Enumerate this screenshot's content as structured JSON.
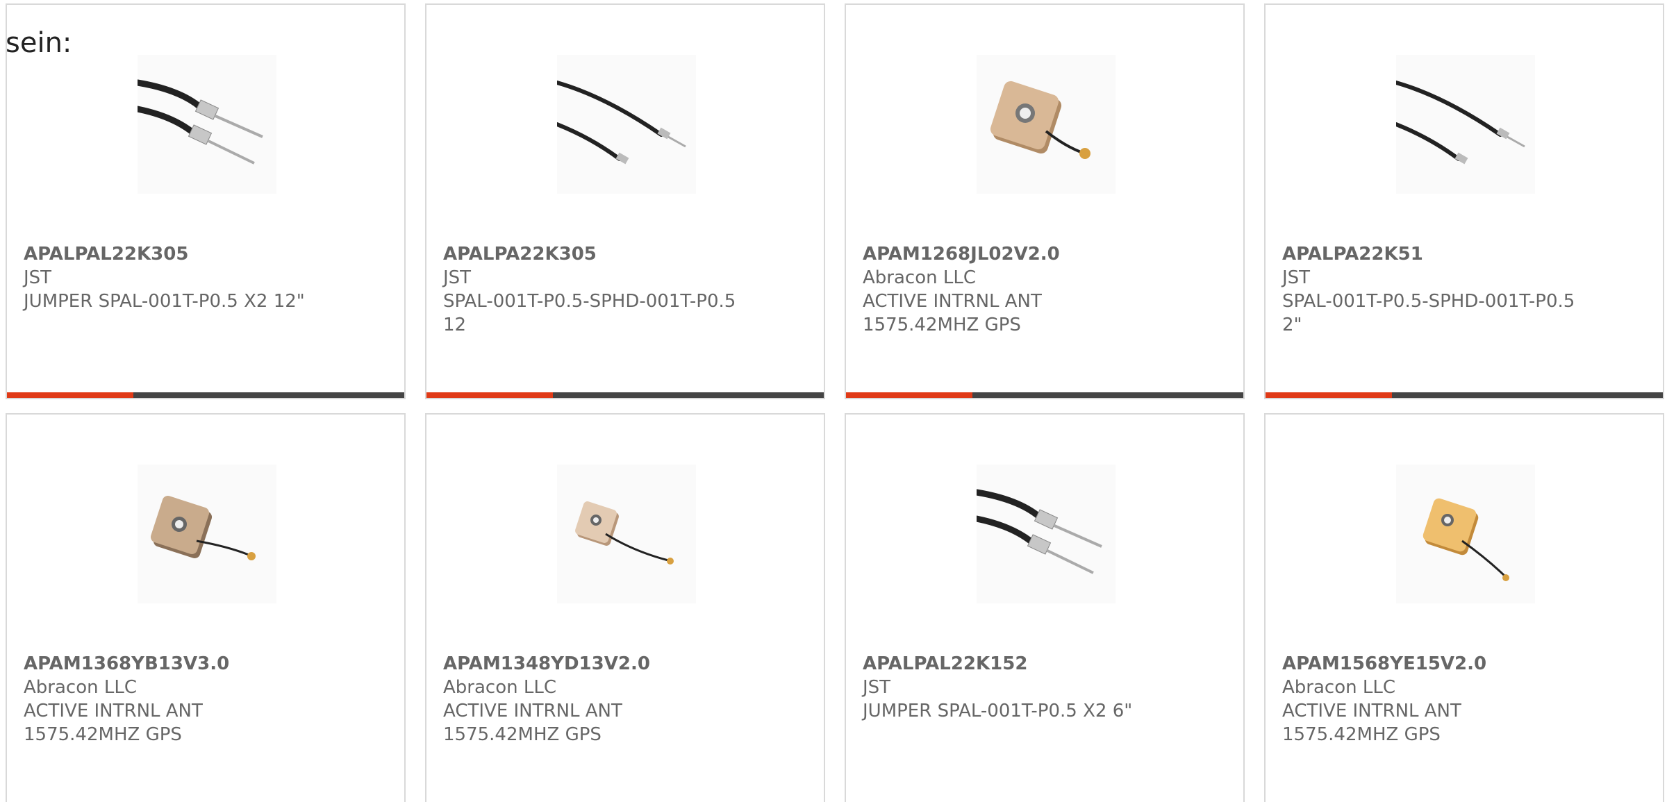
{
  "intro_text": "sein:",
  "accent_color": "#e03a17",
  "bar_color": "#444444",
  "products": [
    {
      "part_number": "APALPAL22K305",
      "manufacturer": "JST",
      "description": "JUMPER SPAL-001T-P0.5 X2 12\"",
      "image": "jumper-cable-two-terminals"
    },
    {
      "part_number": "APALPA22K305",
      "manufacturer": "JST",
      "description": "SPAL-001T-P0.5-SPHD-001T-P0.5 12",
      "image": "jumper-cable-single"
    },
    {
      "part_number": "APAM1268JL02V2.0",
      "manufacturer": "Abracon LLC",
      "description": "ACTIVE INTRNL ANT 1575.42MHZ GPS",
      "image": "gps-patch-antenna"
    },
    {
      "part_number": "APALPA22K51",
      "manufacturer": "JST",
      "description": "SPAL-001T-P0.5-SPHD-001T-P0.5 2\"",
      "image": "jumper-cable-single"
    },
    {
      "part_number": "APAM1368YB13V3.0",
      "manufacturer": "Abracon LLC",
      "description": "ACTIVE INTRNL ANT 1575.42MHZ GPS",
      "image": "gps-patch-antenna"
    },
    {
      "part_number": "APAM1348YD13V2.0",
      "manufacturer": "Abracon LLC",
      "description": "ACTIVE INTRNL ANT 1575.42MHZ GPS",
      "image": "gps-patch-antenna"
    },
    {
      "part_number": "APALPAL22K152",
      "manufacturer": "JST",
      "description": "JUMPER SPAL-001T-P0.5 X2 6\"",
      "image": "jumper-cable-two-terminals"
    },
    {
      "part_number": "APAM1568YE15V2.0",
      "manufacturer": "Abracon LLC",
      "description": "ACTIVE INTRNL ANT 1575.42MHZ GPS",
      "image": "gps-patch-antenna"
    }
  ]
}
